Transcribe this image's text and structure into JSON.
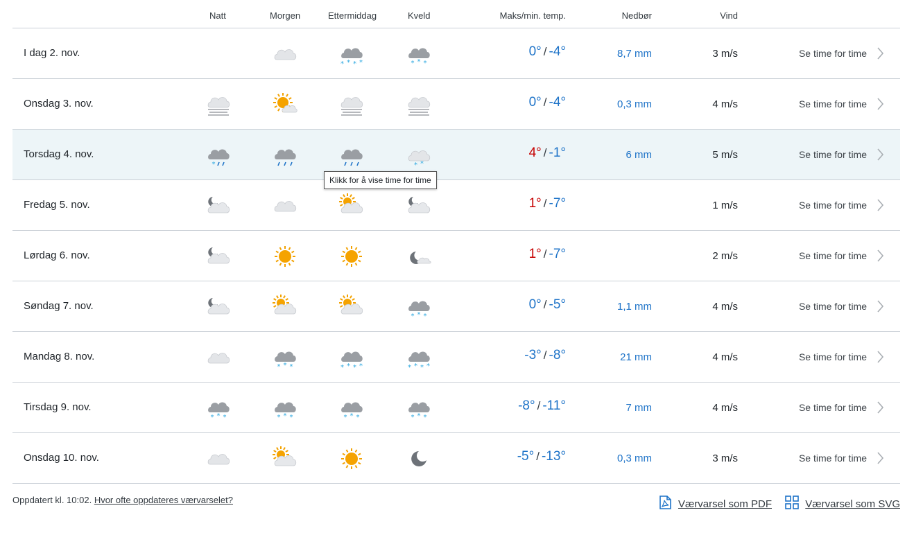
{
  "columns": {
    "night": "Natt",
    "morning": "Morgen",
    "afternoon": "Ettermiddag",
    "evening": "Kveld",
    "temp": "Maks/min. temp.",
    "precip": "Nedbør",
    "wind": "Vind"
  },
  "hourly_label": "Se time for time",
  "tooltip": "Klikk for å vise time for time",
  "days": [
    {
      "day": "I dag 2. nov.",
      "icons": [
        "none",
        "cloudy",
        "heavysnow",
        "snow"
      ],
      "max": "0°",
      "max_positive": false,
      "min": "-4°",
      "precip": "8,7 mm",
      "wind": "3 m/s"
    },
    {
      "day": "Onsdag 3. nov.",
      "icons": [
        "fog",
        "partlycloudy",
        "fog",
        "fog"
      ],
      "max": "0°",
      "max_positive": false,
      "min": "-4°",
      "precip": "0,3 mm",
      "wind": "4 m/s"
    },
    {
      "day": "Torsdag 4. nov.",
      "icons": [
        "sleet",
        "rain",
        "rain",
        "lightsnow"
      ],
      "max": "4°",
      "max_positive": true,
      "min": "-1°",
      "precip": "6 mm",
      "wind": "5 m/s"
    },
    {
      "day": "Fredag 5. nov.",
      "icons": [
        "partlycloudy-night",
        "cloudy",
        "partlycloudy-sun",
        "partlycloudy-night"
      ],
      "max": "1°",
      "max_positive": true,
      "min": "-7°",
      "precip": "",
      "wind": "1 m/s"
    },
    {
      "day": "Lørdag 6. nov.",
      "icons": [
        "partlycloudy-night",
        "clearsky",
        "clearsky",
        "fair-night"
      ],
      "max": "1°",
      "max_positive": true,
      "min": "-7°",
      "precip": "",
      "wind": "2 m/s"
    },
    {
      "day": "Søndag 7. nov.",
      "icons": [
        "partlycloudy-night",
        "partlycloudy-sun",
        "partlycloudy-sun",
        "snow"
      ],
      "max": "0°",
      "max_positive": false,
      "min": "-5°",
      "precip": "1,1 mm",
      "wind": "4 m/s"
    },
    {
      "day": "Mandag 8. nov.",
      "icons": [
        "cloudy",
        "snow",
        "heavysnow",
        "heavysnow"
      ],
      "max": "-3°",
      "max_positive": false,
      "min": "-8°",
      "precip": "21 mm",
      "wind": "4 m/s"
    },
    {
      "day": "Tirsdag 9. nov.",
      "icons": [
        "snow",
        "snow",
        "snow",
        "snow"
      ],
      "max": "-8°",
      "max_positive": false,
      "min": "-11°",
      "precip": "7 mm",
      "wind": "4 m/s"
    },
    {
      "day": "Onsdag 10. nov.",
      "icons": [
        "cloudy",
        "partlycloudy-sun",
        "clearsky",
        "moon"
      ],
      "max": "-5°",
      "max_positive": false,
      "min": "-13°",
      "precip": "0,3 mm",
      "wind": "3 m/s"
    }
  ],
  "footer": {
    "updated": "Oppdatert kl. 10:02.",
    "update_link": "Hvor ofte oppdateres værvarselet?",
    "pdf_link": "Værvarsel som PDF",
    "svg_link": "Værvarsel som SVG"
  },
  "colors": {
    "accent": "#1e73c8",
    "positive_temp": "#c60000",
    "highlight_row": "#edf5f8",
    "divider": "#c9cfd6"
  }
}
